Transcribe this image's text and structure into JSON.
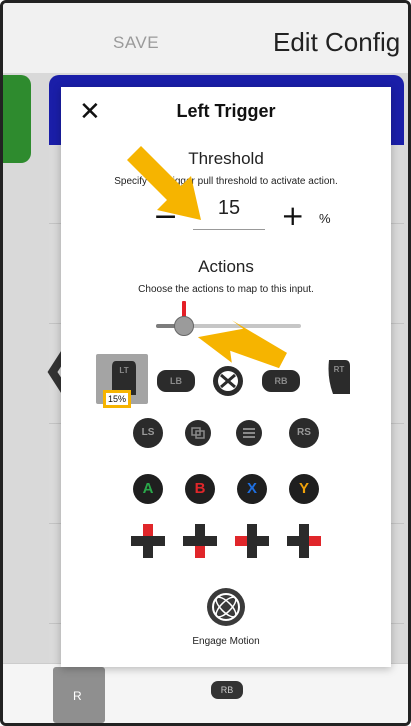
{
  "topbar": {
    "save_label": "SAVE",
    "title": "Edit Config"
  },
  "background": {
    "chevron": "❮",
    "bottom_tile_label": "R",
    "rb_label": "RB"
  },
  "dialog": {
    "close_icon": "✕",
    "title": "Left Trigger",
    "threshold": {
      "title": "Threshold",
      "description": "Specify the trigger pull threshold to activate action.",
      "minus_label": "−",
      "value": "15",
      "plus_label": "+",
      "unit": "%"
    },
    "actions": {
      "title": "Actions",
      "description": "Choose the actions to map to this input.",
      "slider_value_percent": 15
    },
    "selected_action_badge": "15%",
    "buttons_row1": [
      "LT",
      "LB",
      "Xbox",
      "RB",
      "RT"
    ],
    "buttons_row2": [
      "LS",
      "View",
      "Menu",
      "RS"
    ],
    "face_buttons": [
      {
        "label": "A",
        "color": "#2aa84a"
      },
      {
        "label": "B",
        "color": "#e0262a"
      },
      {
        "label": "X",
        "color": "#1f6fe0"
      },
      {
        "label": "Y",
        "color": "#f0a20a"
      }
    ],
    "dpad": [
      "dpad-up-icon",
      "dpad-down-icon",
      "dpad-left-icon",
      "dpad-right-icon"
    ],
    "engage_motion_label": "Engage Motion"
  },
  "colors": {
    "accent_highlight": "#f6b400",
    "header_blue": "#1a1ea8",
    "edge_green": "#2e8b2e",
    "trigger_red": "#e41e26"
  }
}
